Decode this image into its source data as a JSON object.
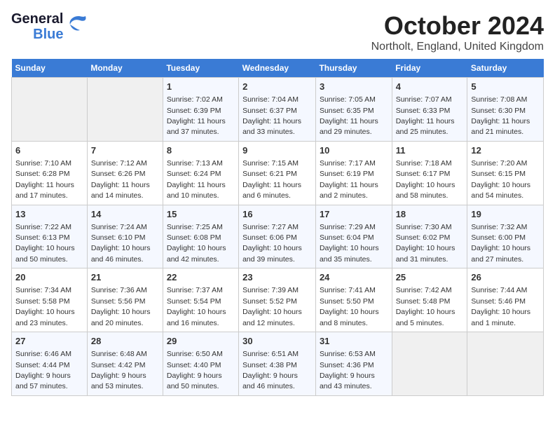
{
  "logo": {
    "line1": "General",
    "line2": "Blue"
  },
  "title": "October 2024",
  "location": "Northolt, England, United Kingdom",
  "days_of_week": [
    "Sunday",
    "Monday",
    "Tuesday",
    "Wednesday",
    "Thursday",
    "Friday",
    "Saturday"
  ],
  "weeks": [
    [
      {
        "day": "",
        "empty": true
      },
      {
        "day": "",
        "empty": true
      },
      {
        "day": "1",
        "sunrise": "7:02 AM",
        "sunset": "6:39 PM",
        "daylight": "11 hours and 37 minutes."
      },
      {
        "day": "2",
        "sunrise": "7:04 AM",
        "sunset": "6:37 PM",
        "daylight": "11 hours and 33 minutes."
      },
      {
        "day": "3",
        "sunrise": "7:05 AM",
        "sunset": "6:35 PM",
        "daylight": "11 hours and 29 minutes."
      },
      {
        "day": "4",
        "sunrise": "7:07 AM",
        "sunset": "6:33 PM",
        "daylight": "11 hours and 25 minutes."
      },
      {
        "day": "5",
        "sunrise": "7:08 AM",
        "sunset": "6:30 PM",
        "daylight": "11 hours and 21 minutes."
      }
    ],
    [
      {
        "day": "6",
        "sunrise": "7:10 AM",
        "sunset": "6:28 PM",
        "daylight": "11 hours and 17 minutes."
      },
      {
        "day": "7",
        "sunrise": "7:12 AM",
        "sunset": "6:26 PM",
        "daylight": "11 hours and 14 minutes."
      },
      {
        "day": "8",
        "sunrise": "7:13 AM",
        "sunset": "6:24 PM",
        "daylight": "11 hours and 10 minutes."
      },
      {
        "day": "9",
        "sunrise": "7:15 AM",
        "sunset": "6:21 PM",
        "daylight": "11 hours and 6 minutes."
      },
      {
        "day": "10",
        "sunrise": "7:17 AM",
        "sunset": "6:19 PM",
        "daylight": "11 hours and 2 minutes."
      },
      {
        "day": "11",
        "sunrise": "7:18 AM",
        "sunset": "6:17 PM",
        "daylight": "10 hours and 58 minutes."
      },
      {
        "day": "12",
        "sunrise": "7:20 AM",
        "sunset": "6:15 PM",
        "daylight": "10 hours and 54 minutes."
      }
    ],
    [
      {
        "day": "13",
        "sunrise": "7:22 AM",
        "sunset": "6:13 PM",
        "daylight": "10 hours and 50 minutes."
      },
      {
        "day": "14",
        "sunrise": "7:24 AM",
        "sunset": "6:10 PM",
        "daylight": "10 hours and 46 minutes."
      },
      {
        "day": "15",
        "sunrise": "7:25 AM",
        "sunset": "6:08 PM",
        "daylight": "10 hours and 42 minutes."
      },
      {
        "day": "16",
        "sunrise": "7:27 AM",
        "sunset": "6:06 PM",
        "daylight": "10 hours and 39 minutes."
      },
      {
        "day": "17",
        "sunrise": "7:29 AM",
        "sunset": "6:04 PM",
        "daylight": "10 hours and 35 minutes."
      },
      {
        "day": "18",
        "sunrise": "7:30 AM",
        "sunset": "6:02 PM",
        "daylight": "10 hours and 31 minutes."
      },
      {
        "day": "19",
        "sunrise": "7:32 AM",
        "sunset": "6:00 PM",
        "daylight": "10 hours and 27 minutes."
      }
    ],
    [
      {
        "day": "20",
        "sunrise": "7:34 AM",
        "sunset": "5:58 PM",
        "daylight": "10 hours and 23 minutes."
      },
      {
        "day": "21",
        "sunrise": "7:36 AM",
        "sunset": "5:56 PM",
        "daylight": "10 hours and 20 minutes."
      },
      {
        "day": "22",
        "sunrise": "7:37 AM",
        "sunset": "5:54 PM",
        "daylight": "10 hours and 16 minutes."
      },
      {
        "day": "23",
        "sunrise": "7:39 AM",
        "sunset": "5:52 PM",
        "daylight": "10 hours and 12 minutes."
      },
      {
        "day": "24",
        "sunrise": "7:41 AM",
        "sunset": "5:50 PM",
        "daylight": "10 hours and 8 minutes."
      },
      {
        "day": "25",
        "sunrise": "7:42 AM",
        "sunset": "5:48 PM",
        "daylight": "10 hours and 5 minutes."
      },
      {
        "day": "26",
        "sunrise": "7:44 AM",
        "sunset": "5:46 PM",
        "daylight": "10 hours and 1 minute."
      }
    ],
    [
      {
        "day": "27",
        "sunrise": "6:46 AM",
        "sunset": "4:44 PM",
        "daylight": "9 hours and 57 minutes."
      },
      {
        "day": "28",
        "sunrise": "6:48 AM",
        "sunset": "4:42 PM",
        "daylight": "9 hours and 53 minutes."
      },
      {
        "day": "29",
        "sunrise": "6:50 AM",
        "sunset": "4:40 PM",
        "daylight": "9 hours and 50 minutes."
      },
      {
        "day": "30",
        "sunrise": "6:51 AM",
        "sunset": "4:38 PM",
        "daylight": "9 hours and 46 minutes."
      },
      {
        "day": "31",
        "sunrise": "6:53 AM",
        "sunset": "4:36 PM",
        "daylight": "9 hours and 43 minutes."
      },
      {
        "day": "",
        "empty": true
      },
      {
        "day": "",
        "empty": true
      }
    ]
  ]
}
